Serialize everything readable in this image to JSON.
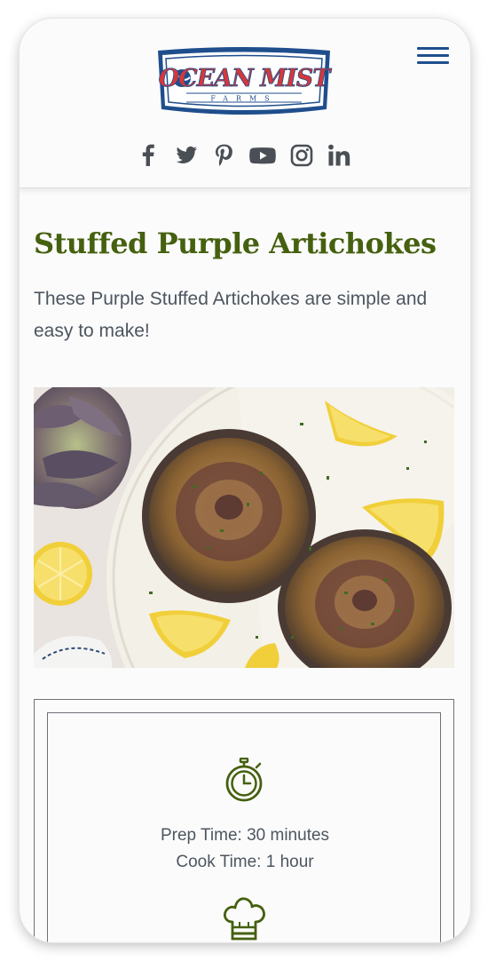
{
  "header": {
    "logo_text": "OCEAN MIST",
    "logo_subtext": "FARMS",
    "menu_icon": "hamburger-menu-icon",
    "social": [
      {
        "name": "facebook-icon"
      },
      {
        "name": "twitter-icon"
      },
      {
        "name": "pinterest-icon"
      },
      {
        "name": "youtube-icon"
      },
      {
        "name": "instagram-icon"
      },
      {
        "name": "linkedin-icon"
      }
    ]
  },
  "recipe": {
    "title": "Stuffed Purple Artichokes",
    "intro": "These Purple Stuffed Artichokes are simple and easy to make!",
    "prep_time": "Prep Time: 30 minutes",
    "cook_time": "Cook Time: 1 hour"
  },
  "colors": {
    "title_green": "#45600f",
    "brand_blue": "#1f4e8c",
    "brand_red": "#d6373a",
    "text_gray": "#4d5660",
    "icon_gray": "#4a4f55"
  }
}
